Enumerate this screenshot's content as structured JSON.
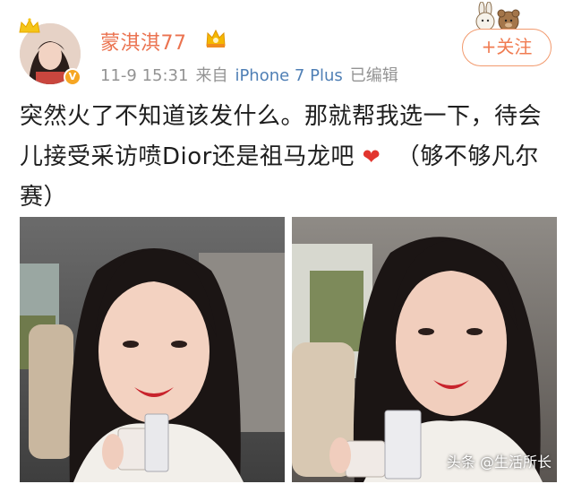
{
  "post": {
    "username": "蒙淇淇77",
    "date": "11-9 15:31",
    "source_prefix": "来自",
    "device": "iPhone 7 Plus",
    "edited": "已编辑",
    "follow_label": "+关注",
    "text_part1": "突然火了不知道该发什么。那就帮我选一下，待会儿接受采访喷Dior还是祖马龙吧",
    "text_part2": "（够不够凡尔赛）",
    "heart": "❤"
  },
  "watermark": "头条 @生活所长",
  "colors": {
    "username": "#eb7350",
    "meta": "#939393",
    "device_link": "#4f7fb5",
    "follow": "#f07c52",
    "heart": "#e2352e"
  },
  "icons": [
    "crown-icon",
    "verified-v-icon",
    "vip-crown-badge-icon",
    "rabbit-sticker-icon"
  ]
}
